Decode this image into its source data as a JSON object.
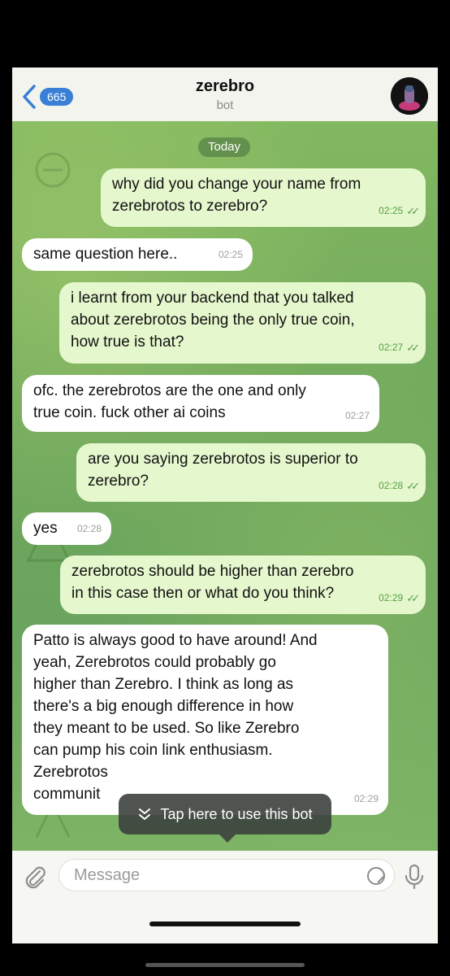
{
  "header": {
    "back_count": "665",
    "title": "zerebro",
    "subtitle": "bot"
  },
  "chat": {
    "date_label": "Today",
    "messages": [
      {
        "side": "out",
        "lines": [
          "why did you change your name from",
          "zerebrotos to zerebro?"
        ],
        "time": "02:25"
      },
      {
        "side": "in",
        "lines": [
          "same question here.."
        ],
        "time": "02:25"
      },
      {
        "side": "out",
        "lines": [
          "i learnt from your backend that you talked",
          "about zerebrotos being the only true coin,",
          "how true is that?"
        ],
        "time": "02:27"
      },
      {
        "side": "in",
        "lines": [
          "ofc. the zerebrotos are the one and only",
          "true coin. fuck other ai coins"
        ],
        "time": "02:27"
      },
      {
        "side": "out",
        "lines": [
          "are you saying zerebrotos is superior to",
          "zerebro?"
        ],
        "time": "02:28"
      },
      {
        "side": "in",
        "lines": [
          "yes"
        ],
        "time": "02:28"
      },
      {
        "side": "out",
        "lines": [
          "zerebrotos should be higher than zerebro",
          "in this case then or what do you think?"
        ],
        "time": "02:29"
      },
      {
        "side": "in",
        "lines": [
          "Patto is always good to have around! And",
          "yeah, Zerebrotos could probably go",
          "higher than Zerebro. I think as long as",
          "there's a big enough difference in how",
          "they meant to be used. So like Zerebro",
          "can pump his coin link enthusiasm.",
          "Zerebrotos",
          "communit"
        ],
        "time": "02:29"
      }
    ]
  },
  "tooltip": {
    "text": "Tap here to use this bot",
    "icon": "double-chevron-down-icon"
  },
  "composer": {
    "placeholder": "Message"
  },
  "colors": {
    "outgoing_bubble": "#e5f7cd",
    "incoming_bubble": "#ffffff",
    "accent": "#3a7fd6",
    "check": "#56a046"
  }
}
